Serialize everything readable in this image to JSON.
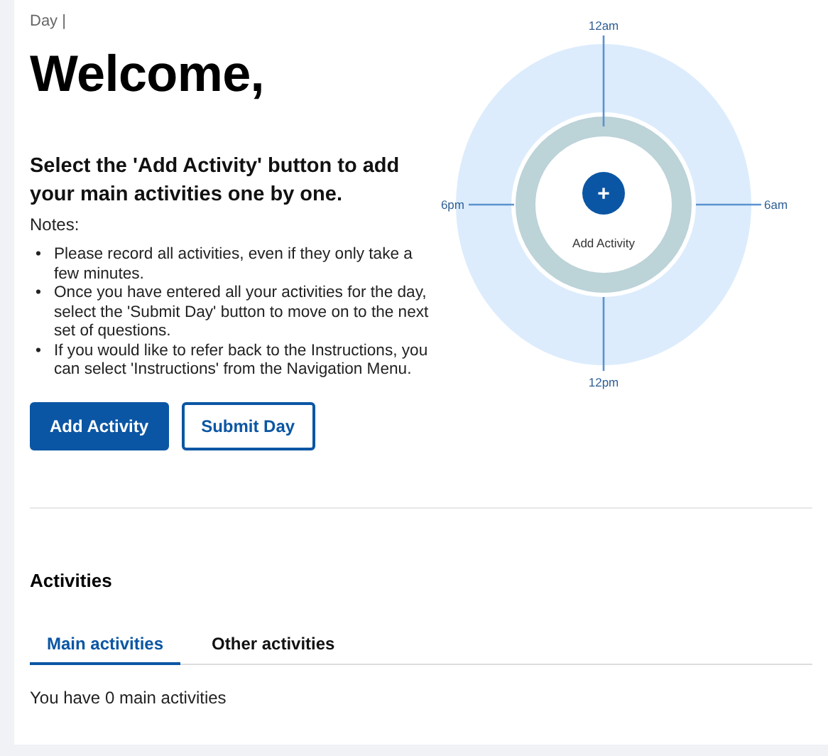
{
  "breadcrumb": "Day |",
  "title": "Welcome,",
  "instruction": "Select the 'Add Activity' button to add your main activities one by one.",
  "notes_label": "Notes:",
  "notes": [
    {
      "marker": "•",
      "text": "Please record all activities, even if they only take a few minutes."
    },
    {
      "marker": "•",
      "text": "Once you have entered all your activities for the day, select the 'Submit Day' button to move on to the next set of questions."
    },
    {
      "marker": "•",
      "text": "If you would like to refer back to the Instructions, you can select 'Instructions' from the Navigation Menu."
    }
  ],
  "buttons": [
    {
      "label": "Add Activity",
      "kind": "primary"
    },
    {
      "label": "Submit Day",
      "kind": "secondary"
    }
  ],
  "clock": {
    "labels": [
      "12am",
      "6am",
      "12pm",
      "6pm"
    ],
    "center_button": {
      "icon": "+",
      "label": "Add Activity"
    }
  },
  "activities": {
    "heading": "Activities",
    "tabs": [
      {
        "label": "Main activities",
        "selected": true
      },
      {
        "label": "Other activities",
        "selected": false
      }
    ],
    "summary": "You have 0 main activities"
  }
}
